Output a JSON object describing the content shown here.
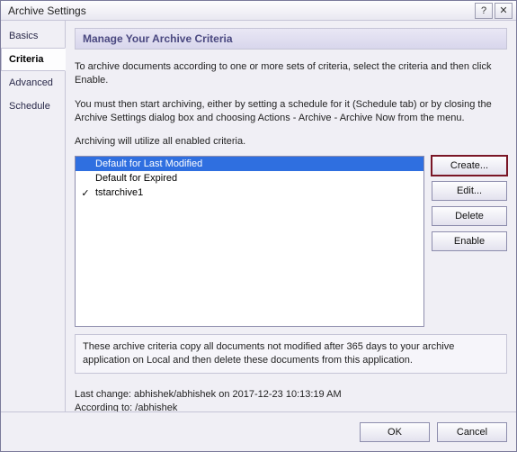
{
  "window": {
    "title": "Archive Settings"
  },
  "tabs": {
    "items": [
      {
        "label": "Basics"
      },
      {
        "label": "Criteria"
      },
      {
        "label": "Advanced"
      },
      {
        "label": "Schedule"
      }
    ]
  },
  "panel": {
    "heading": "Manage Your Archive Criteria",
    "intro1": "To archive documents according to one or more sets of criteria, select the criteria and then click Enable.",
    "intro2": "You must then start archiving, either by setting a schedule for it (Schedule tab) or by closing the Archive Settings dialog box and choosing Actions - Archive - Archive Now from the menu.",
    "intro3": "Archiving will utilize all enabled criteria."
  },
  "criteria": {
    "items": [
      {
        "checked": "",
        "label": "Default for Last Modified",
        "selected": true
      },
      {
        "checked": "",
        "label": "Default for Expired",
        "selected": false
      },
      {
        "checked": "✓",
        "label": "tstarchive1",
        "selected": false
      }
    ]
  },
  "buttons": {
    "create": "Create...",
    "edit": "Edit...",
    "delete": "Delete",
    "enable": "Enable"
  },
  "info": "These archive criteria copy all documents not modified after 365 days to your archive application  on Local and then delete these documents from this application.",
  "meta": {
    "lastchange": "Last change: abhishek/abhishek on 2017-12-23 10:13:19 AM",
    "accordingto": "According to: /abhishek"
  },
  "footer": {
    "ok": "OK",
    "cancel": "Cancel"
  }
}
